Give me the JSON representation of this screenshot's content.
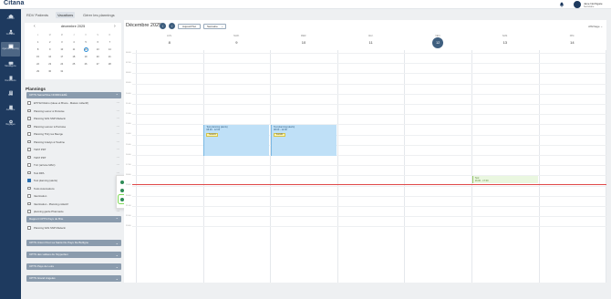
{
  "header": {
    "logo": "Citana",
    "user_name": "Jane Northgate",
    "user_role": "Secrétaire"
  },
  "sidebar": {
    "items": [
      {
        "label": "Accueil",
        "icon": "home-icon"
      },
      {
        "label": "Contacts",
        "icon": "contacts-icon"
      },
      {
        "label": "Agenda Planning",
        "icon": "calendar-icon"
      },
      {
        "label": "Messagerie",
        "icon": "chat-icon"
      },
      {
        "label": "Documents",
        "icon": "document-icon"
      },
      {
        "label": "Suivi",
        "icon": "tracking-icon"
      },
      {
        "label": "Annuaire",
        "icon": "directory-icon"
      },
      {
        "label": "Réglages",
        "icon": "settings-icon"
      }
    ]
  },
  "tabs": [
    "RDV Patients",
    "Vacations",
    "Gérer les plannings"
  ],
  "minical": {
    "title": "décembre 2025",
    "dow": [
      "L",
      "M",
      "M",
      "J",
      "V",
      "S",
      "D"
    ],
    "weeks": [
      [
        "1",
        "2",
        "3",
        "4",
        "5",
        "6",
        "7"
      ],
      [
        "8",
        "9",
        "10",
        "11",
        "12",
        "13",
        "14"
      ],
      [
        "15",
        "16",
        "17",
        "18",
        "19",
        "20",
        "21"
      ],
      [
        "22",
        "23",
        "24",
        "25",
        "26",
        "27",
        "28"
      ],
      [
        "29",
        "30",
        "31",
        "",
        "",
        "",
        ""
      ]
    ]
  },
  "planning": {
    "title": "Plannings",
    "group1": "CPTS Seine/Oise NORD/LEZÉ",
    "items": [
      "ETP El Nidoro (ideue et Bruce - Maison collectif)",
      "Planning Lamor à Pontoise",
      "Planning SAS SNP Médecin",
      "Planning Lamour à Pontoise",
      "Planning Thiry les Beurge",
      "Planning Gradys à l'Ivodine",
      "TEST PDT",
      "TEST PDT",
      "TLC (arrivée MAC)",
      "Test RPA",
      "Test planning (alerts)",
      "Tests Automations",
      "Vaccination",
      "Vaccination - Planning collectif",
      "planning garde Pharmacie"
    ],
    "checked_index": 10,
    "group2": "Rapport CPTS Pays de Brie",
    "group2_items": [
      "Planning SAS SNP Médecin"
    ],
    "more_groups": [
      "CPTS Union Pour La Santé Du Pays De Bulligne",
      "CPTS des vallées de l'Hyperlien",
      "CPTS Pays de Loire",
      "CPTS Grand Angeles"
    ]
  },
  "context_menu": [
    "Informations du planning",
    "Générer une disponibilité",
    "Planifier un incident"
  ],
  "calendar": {
    "title": "Décembre 2025",
    "today_label": "Aujourd'hui",
    "view_select": "Semaine",
    "affichage": "Affichage",
    "days": [
      {
        "dow": "LUN.",
        "num": "8"
      },
      {
        "dow": "MAR.",
        "num": "9"
      },
      {
        "dow": "MER.",
        "num": "10"
      },
      {
        "dow": "JEU.",
        "num": "11"
      },
      {
        "dow": "VEN.",
        "num": "12"
      },
      {
        "dow": "SAM.",
        "num": "13"
      },
      {
        "dow": "DIM.",
        "num": "14"
      }
    ],
    "today_index": 4,
    "hours": [
      "06:00",
      "07:00",
      "08:00",
      "09:00",
      "10:00",
      "11:00",
      "12:00",
      "13:00",
      "14:00",
      "15:00",
      "16:00",
      "17:00",
      "18:00",
      "19:00",
      "20:00",
      "21:00",
      "22:00",
      "23:00"
    ],
    "events": [
      {
        "title": "Test planning (alerts)",
        "time": "08:00 - 12:00",
        "badge": "Tests01"
      },
      {
        "title": "Test planning (alerts)",
        "time": "08:00 - 12:00",
        "badge": "Tests01"
      },
      {
        "title": "Test",
        "time": "16:00 - 17:00"
      }
    ]
  },
  "colors": {
    "sidebar": "#1e3a5f",
    "accent": "#3f5f7f",
    "event": "#bfe0f7",
    "now_line": "#e04848",
    "highlight": "#7ed957"
  }
}
